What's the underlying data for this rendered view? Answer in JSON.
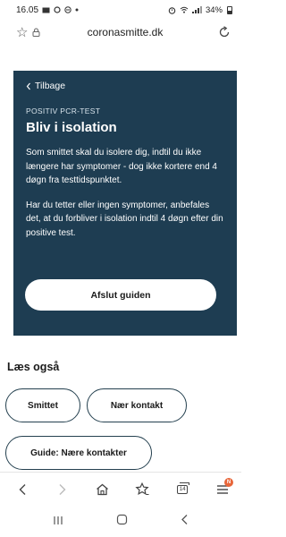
{
  "status_bar": {
    "time": "16.05",
    "left_icons": [
      "mail-icon",
      "settings-icon",
      "dnd-icon",
      "dot-icon"
    ],
    "right_icons": [
      "alarm-icon",
      "wifi-icon",
      "signal-icon"
    ],
    "battery_text": "34%"
  },
  "url_bar": {
    "url": "coronasmitte.dk"
  },
  "hero": {
    "back_label": "Tilbage",
    "kicker": "POSITIV PCR-TEST",
    "title": "Bliv i isolation",
    "paragraph_1": "Som smittet skal du isolere dig, indtil du ikke længere har symptomer - dog ikke kortere end 4 døgn fra testtidspunktet.",
    "paragraph_2": "Har du tetter eller ingen symptomer, anbefales det, at du forbliver i isolation indtil 4 døgn efter din positive test.",
    "button_label": "Afslut guiden",
    "background": "#1e3d52"
  },
  "read_also": {
    "title": "Læs også",
    "chips": [
      {
        "label": "Smittet"
      },
      {
        "label": "Nær kontakt"
      },
      {
        "label": "Guide: Nære kontakter"
      }
    ]
  },
  "browser_nav": {
    "tab_count": "14",
    "menu_badge": "N",
    "badge_color": "#e8663a"
  }
}
